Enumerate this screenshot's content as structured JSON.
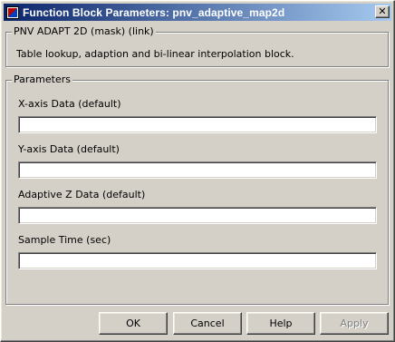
{
  "window": {
    "title": "Function Block Parameters: pnv_adaptive_map2d",
    "app_icon": "simulink-block-icon",
    "close_label": "✕"
  },
  "mask_group": {
    "label": "PNV ADAPT 2D (mask) (link)",
    "description": "Table lookup, adaption and bi-linear interpolation block."
  },
  "parameters_group": {
    "label": "Parameters",
    "fields": [
      {
        "label": "X-axis Data (default)",
        "value": ""
      },
      {
        "label": "Y-axis Data (default)",
        "value": ""
      },
      {
        "label": "Adaptive Z Data (default)",
        "value": ""
      },
      {
        "label": "Sample Time (sec)",
        "value": ""
      }
    ]
  },
  "buttons": {
    "ok": "OK",
    "cancel": "Cancel",
    "help": "Help",
    "apply": "Apply"
  },
  "colors": {
    "title_gradient_start": "#0a246a",
    "title_gradient_end": "#a6caf0",
    "face": "#d4d0c8"
  }
}
